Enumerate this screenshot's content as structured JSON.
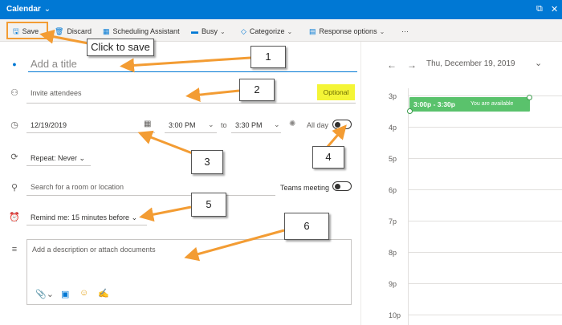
{
  "titlebar": {
    "title": "Calendar",
    "chevron": "⌄"
  },
  "toolbar": {
    "save": "Save",
    "discard": "Discard",
    "scheduling": "Scheduling Assistant",
    "busy": "Busy",
    "categorize": "Categorize",
    "response": "Response options",
    "more": "···"
  },
  "form": {
    "title_placeholder": "Add a title",
    "attendees_placeholder": "Invite attendees",
    "optional": "Optional",
    "start_date": "12/19/2019",
    "start_time": "3:00 PM",
    "to": "to",
    "end_time": "3:30 PM",
    "all_day": "All day",
    "repeat": "Repeat: Never",
    "location_placeholder": "Search for a room or location",
    "teams": "Teams meeting",
    "remind": "Remind me: 15 minutes before",
    "description_placeholder": "Add a description or attach documents"
  },
  "calendar": {
    "date": "Thu, December 19, 2019",
    "hours": [
      "3p",
      "4p",
      "5p",
      "6p",
      "7p",
      "8p",
      "9p",
      "10p"
    ],
    "event_time": "3:00p - 3:30p",
    "event_note": "You are available"
  },
  "annotations": {
    "click_to_save": "Click to save",
    "n1": "1",
    "n2": "2",
    "n3": "3",
    "n4": "4",
    "n5": "5",
    "n6": "6"
  },
  "colors": {
    "accent": "#0078d4",
    "event": "#5ac26c",
    "annotation": "#f39c33",
    "highlight": "#f4f536"
  }
}
